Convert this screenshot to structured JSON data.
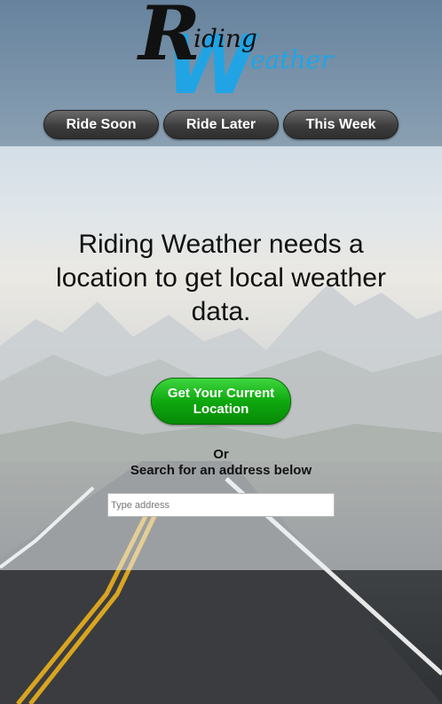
{
  "app": {
    "logo": {
      "letter_r": "R",
      "word_iding": "iding",
      "letter_w": "W",
      "word_eather": "eather",
      "colors": {
        "dark": "#111111",
        "blue": "#1aa6ea"
      }
    }
  },
  "nav": {
    "tabs": [
      {
        "label": "Ride Soon"
      },
      {
        "label": "Ride Later"
      },
      {
        "label": "This Week"
      }
    ]
  },
  "main": {
    "message": "Riding Weather needs a location to get local weather data.",
    "location_button": "Get Your Current Location",
    "or_label": "Or",
    "search_label": "Search for an address below",
    "address_input": {
      "placeholder": "Type address",
      "value": ""
    }
  },
  "theme": {
    "tab_bg": "#3d3d3d",
    "location_button_green": "#0fa80f"
  }
}
